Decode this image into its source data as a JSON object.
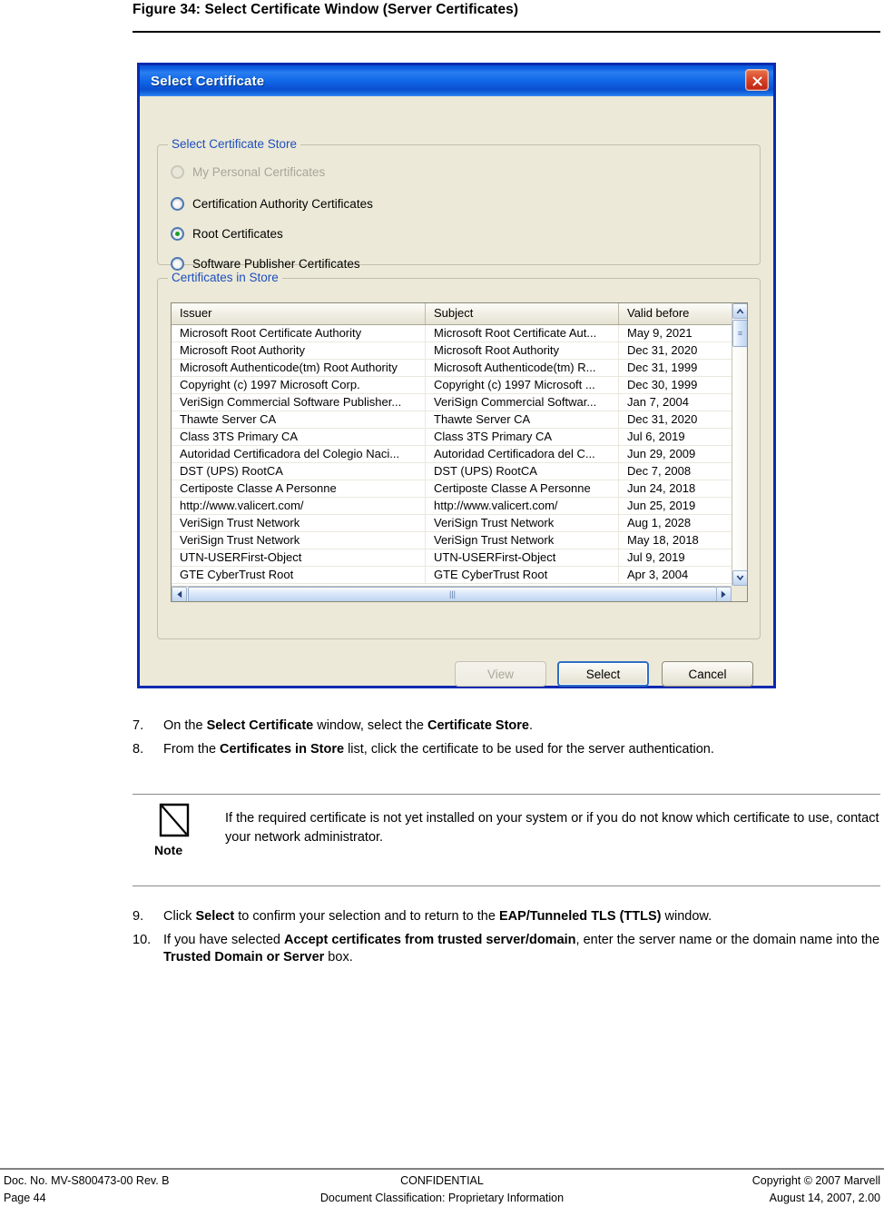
{
  "figure": {
    "caption": "Figure 34: Select Certificate Window (Server Certificates)"
  },
  "dialog": {
    "title": "Select Certificate",
    "close_icon": "close-icon",
    "store_group": {
      "legend": "Select Certificate Store",
      "options": [
        {
          "label": "My Personal Certificates",
          "selected": false,
          "disabled": true
        },
        {
          "label": "Certification Authority Certificates",
          "selected": false,
          "disabled": false
        },
        {
          "label": "Root Certificates",
          "selected": true,
          "disabled": false
        },
        {
          "label": "Software Publisher Certificates",
          "selected": false,
          "disabled": false
        }
      ]
    },
    "list_group": {
      "legend": "Certificates in Store",
      "columns": [
        "Issuer",
        "Subject",
        "Valid before"
      ],
      "rows": [
        [
          "Microsoft Root Certificate Authority",
          "Microsoft Root Certificate Aut...",
          "May 9, 2021"
        ],
        [
          "Microsoft Root Authority",
          "Microsoft Root Authority",
          "Dec 31, 2020"
        ],
        [
          "Microsoft Authenticode(tm) Root Authority",
          "Microsoft Authenticode(tm) R...",
          "Dec 31, 1999"
        ],
        [
          "Copyright (c) 1997 Microsoft Corp.",
          "Copyright (c) 1997 Microsoft ...",
          "Dec 30, 1999"
        ],
        [
          "VeriSign Commercial Software Publisher...",
          "VeriSign Commercial Softwar...",
          "Jan 7, 2004"
        ],
        [
          "Thawte Server CA",
          "Thawte Server CA",
          "Dec 31, 2020"
        ],
        [
          "Class 3TS Primary CA",
          "Class 3TS Primary CA",
          "Jul 6, 2019"
        ],
        [
          "Autoridad Certificadora del Colegio Naci...",
          "Autoridad Certificadora del C...",
          "Jun 29, 2009"
        ],
        [
          "DST (UPS) RootCA",
          "DST (UPS) RootCA",
          "Dec 7, 2008"
        ],
        [
          "Certiposte Classe A Personne",
          "Certiposte Classe A Personne",
          "Jun 24, 2018"
        ],
        [
          "http://www.valicert.com/",
          "http://www.valicert.com/",
          "Jun 25, 2019"
        ],
        [
          "VeriSign Trust Network",
          "VeriSign Trust Network",
          "Aug 1, 2028"
        ],
        [
          "VeriSign Trust Network",
          "VeriSign Trust Network",
          "May 18, 2018"
        ],
        [
          "UTN-USERFirst-Object",
          "UTN-USERFirst-Object",
          "Jul 9, 2019"
        ],
        [
          "GTE CyberTrust Root",
          "GTE CyberTrust Root",
          "Apr 3, 2004"
        ]
      ],
      "scroll": {
        "up_icon": "chevron-up-icon",
        "down_icon": "chevron-down-icon",
        "left_icon": "chevron-left-icon",
        "right_icon": "chevron-right-icon"
      }
    },
    "buttons": [
      {
        "label": "View",
        "state": "disabled"
      },
      {
        "label": "Select",
        "state": "default"
      },
      {
        "label": "Cancel",
        "state": "normal"
      }
    ]
  },
  "steps": [
    {
      "num": "7.",
      "parts": [
        {
          "t": "On the ",
          "b": false
        },
        {
          "t": "Select Certificate",
          "b": true
        },
        {
          "t": " window, select the ",
          "b": false
        },
        {
          "t": "Certificate Store",
          "b": true
        },
        {
          "t": ".",
          "b": false
        }
      ]
    },
    {
      "num": "8.",
      "parts": [
        {
          "t": "From the ",
          "b": false
        },
        {
          "t": "Certificates in Store",
          "b": true
        },
        {
          "t": " list, click the certificate to be used for the server authentication.",
          "b": false
        }
      ]
    },
    {
      "num": "9.",
      "parts": [
        {
          "t": "Click ",
          "b": false
        },
        {
          "t": "Select",
          "b": true
        },
        {
          "t": " to confirm your selection and to return to the ",
          "b": false
        },
        {
          "t": "EAP/Tunneled TLS (TTLS)",
          "b": true
        },
        {
          "t": " window.",
          "b": false
        }
      ]
    },
    {
      "num": "10.",
      "parts": [
        {
          "t": "If you have selected ",
          "b": false
        },
        {
          "t": "Accept certificates from trusted server/domain",
          "b": true
        },
        {
          "t": ", enter the server name or the domain name into the ",
          "b": false
        },
        {
          "t": "Trusted Domain or Server",
          "b": true
        },
        {
          "t": " box.",
          "b": false
        }
      ]
    }
  ],
  "note": {
    "icon": "note-icon",
    "label": "Note",
    "text": "If the required certificate is not yet installed on your system or if you do not know which certificate to use, contact your network administrator."
  },
  "footer": {
    "left_line1": "Doc. No. MV-S800473-00 Rev. B",
    "left_line2": "Page 44",
    "center_line1": "CONFIDENTIAL",
    "center_line2": "Document Classification: Proprietary Information",
    "right_line1": "Copyright © 2007 Marvell",
    "right_line2": "August 14, 2007, 2.00"
  },
  "colors": {
    "titlebar_blue": "#1168e8",
    "dialog_border": "#0a2ab0",
    "dialog_face": "#ece9d8",
    "legend_blue": "#1d4fbe",
    "radio_selected_green": "#1d9d28",
    "close_red": "#d9462a"
  }
}
